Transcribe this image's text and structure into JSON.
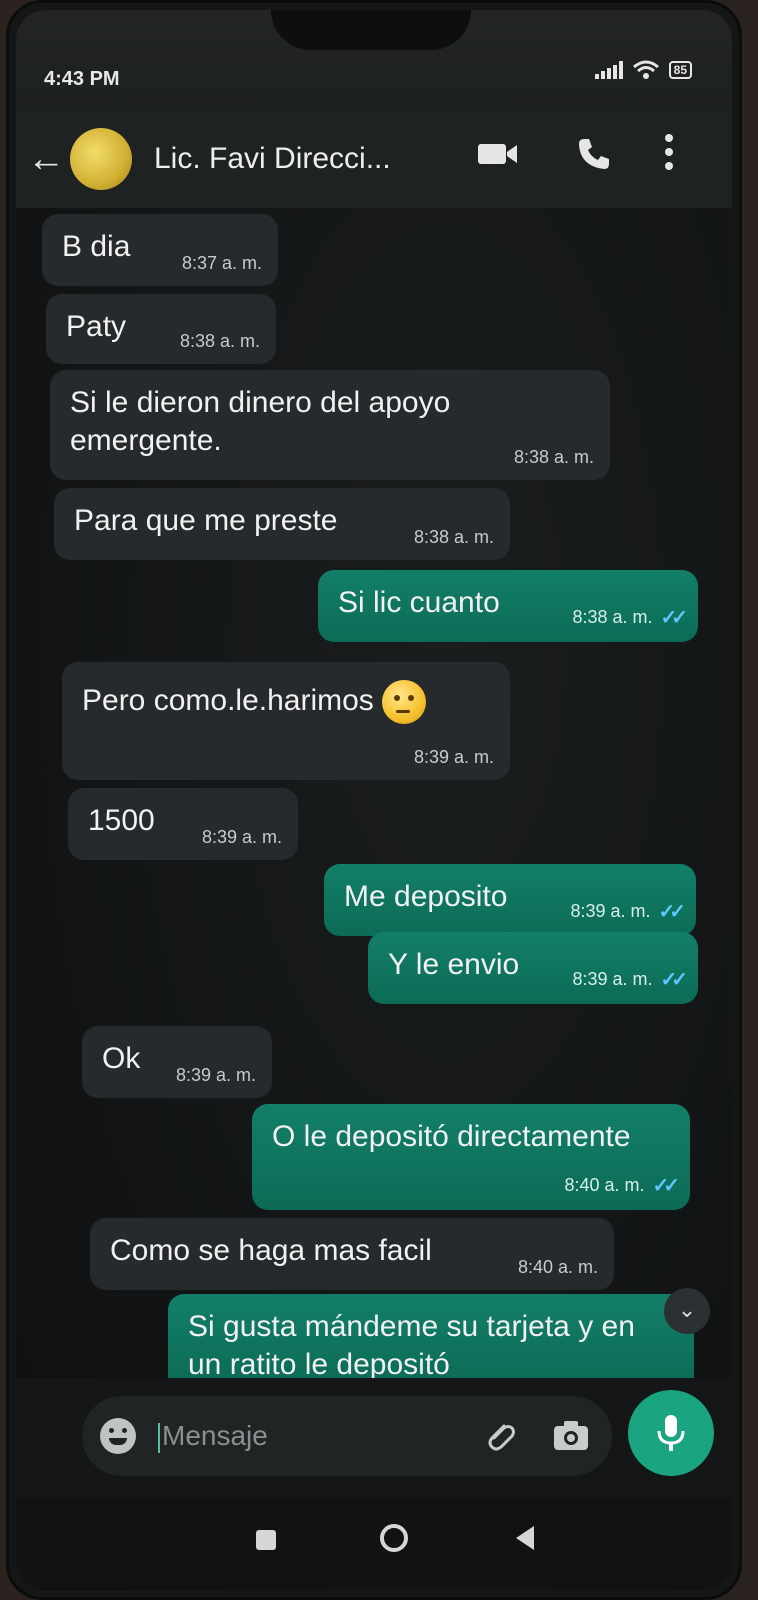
{
  "status_bar": {
    "time": "4:43 PM",
    "battery": "85"
  },
  "header": {
    "contact_name": "Lic. Favi Direcci...",
    "icons": [
      "back-arrow-icon",
      "video-call-icon",
      "phone-icon",
      "more-options-icon"
    ]
  },
  "messages": [
    {
      "direction": "in",
      "text": "B dia",
      "time": "8:37 a. m."
    },
    {
      "direction": "in",
      "text": "Paty",
      "time": "8:38 a. m."
    },
    {
      "direction": "in",
      "text": "Si le dieron dinero del apoyo emergente.",
      "time": "8:38 a. m."
    },
    {
      "direction": "in",
      "text": "Para que me preste",
      "time": "8:38 a. m."
    },
    {
      "direction": "out",
      "text": "Si lic cuanto",
      "time": "8:38 a. m.",
      "status": "read"
    },
    {
      "direction": "in",
      "text": "Pero como.le.harimos",
      "time": "8:39 a. m.",
      "emoji": "thinking-face"
    },
    {
      "direction": "in",
      "text": "1500",
      "time": "8:39 a. m."
    },
    {
      "direction": "out",
      "text": "Me deposito",
      "time": "8:39 a. m.",
      "status": "read"
    },
    {
      "direction": "out",
      "text": "Y le envio",
      "time": "8:39 a. m.",
      "status": "read"
    },
    {
      "direction": "in",
      "text": "Ok",
      "time": "8:39 a. m."
    },
    {
      "direction": "out",
      "text": "O le depositó directamente",
      "time": "8:40 a. m.",
      "status": "read"
    },
    {
      "direction": "in",
      "text": "Como se haga mas facil",
      "time": "8:40 a. m."
    },
    {
      "direction": "out",
      "text": "Si gusta mándeme su tarjeta y en un ratito le depositó",
      "time": "",
      "status": ""
    }
  ],
  "ticks_glyph": "✓✓",
  "scroll_down_glyph": "⌄",
  "input": {
    "placeholder": "Mensaje"
  },
  "colors": {
    "incoming_bubble": "#262a2c",
    "outgoing_bubble": "#0f735e",
    "accent": "#1aa47f",
    "read_ticks": "#5fc7ff"
  }
}
